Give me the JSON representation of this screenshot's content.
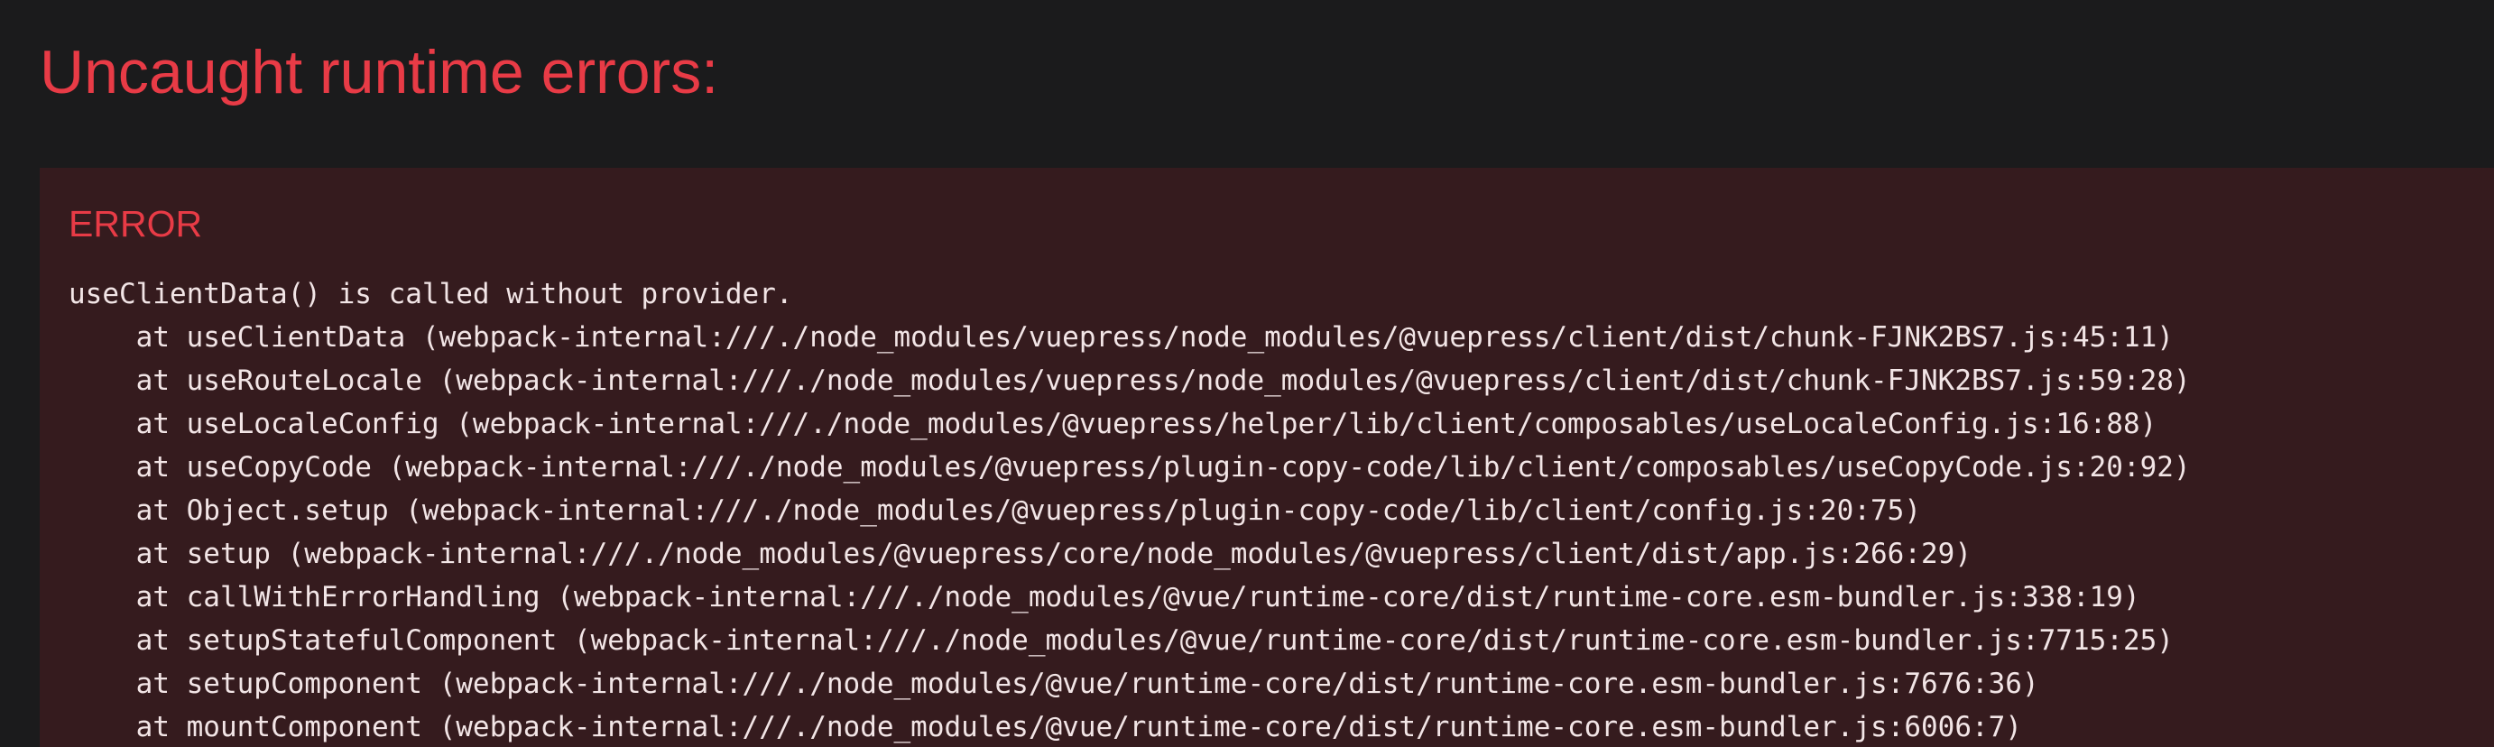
{
  "overlay": {
    "title": "Uncaught runtime errors:",
    "error": {
      "label": "ERROR",
      "message": "useClientData() is called without provider.",
      "stack": [
        "    at useClientData (webpack-internal:///./node_modules/vuepress/node_modules/@vuepress/client/dist/chunk-FJNK2BS7.js:45:11)",
        "    at useRouteLocale (webpack-internal:///./node_modules/vuepress/node_modules/@vuepress/client/dist/chunk-FJNK2BS7.js:59:28)",
        "    at useLocaleConfig (webpack-internal:///./node_modules/@vuepress/helper/lib/client/composables/useLocaleConfig.js:16:88)",
        "    at useCopyCode (webpack-internal:///./node_modules/@vuepress/plugin-copy-code/lib/client/composables/useCopyCode.js:20:92)",
        "    at Object.setup (webpack-internal:///./node_modules/@vuepress/plugin-copy-code/lib/client/config.js:20:75)",
        "    at setup (webpack-internal:///./node_modules/@vuepress/core/node_modules/@vuepress/client/dist/app.js:266:29)",
        "    at callWithErrorHandling (webpack-internal:///./node_modules/@vue/runtime-core/dist/runtime-core.esm-bundler.js:338:19)",
        "    at setupStatefulComponent (webpack-internal:///./node_modules/@vue/runtime-core/dist/runtime-core.esm-bundler.js:7715:25)",
        "    at setupComponent (webpack-internal:///./node_modules/@vue/runtime-core/dist/runtime-core.esm-bundler.js:7676:36)",
        "    at mountComponent (webpack-internal:///./node_modules/@vue/runtime-core/dist/runtime-core.esm-bundler.js:6006:7)"
      ]
    },
    "colors": {
      "background": "#1b1b1c",
      "panel": "#351b1e",
      "accent": "#e83b46",
      "text": "#f2e5e6"
    }
  }
}
